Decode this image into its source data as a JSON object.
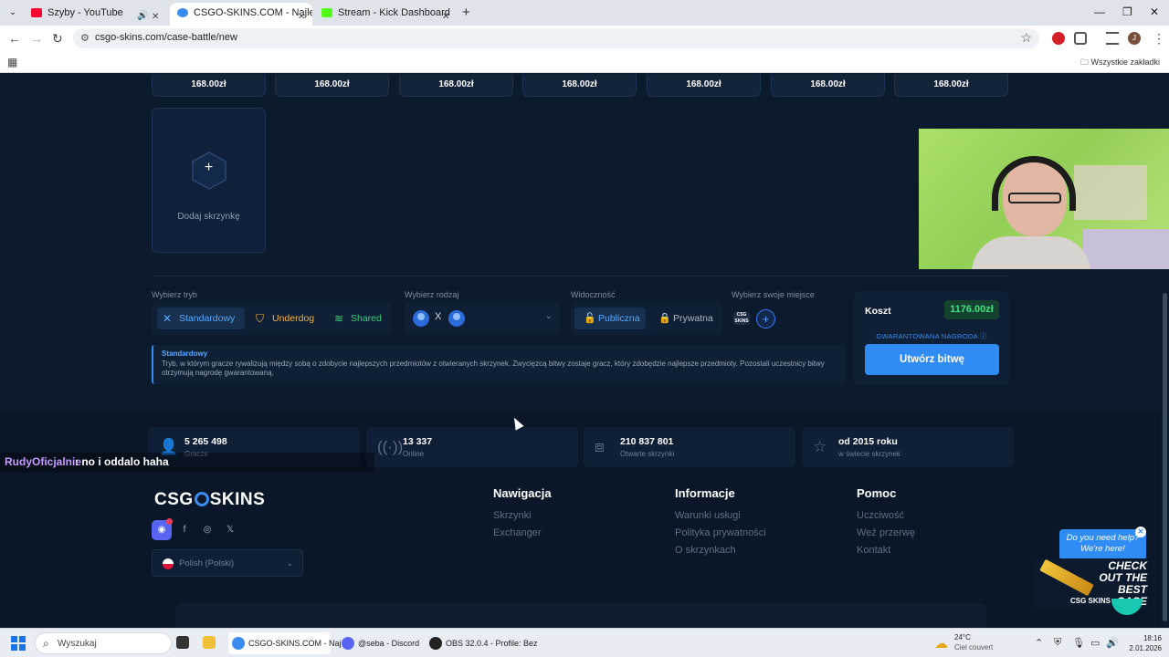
{
  "browser": {
    "tabs": [
      {
        "title": "Szyby - YouTube",
        "favicon_color": "#ff0033",
        "active": false
      },
      {
        "title": "CSGO-SKINS.COM - Najlepsze",
        "favicon_color": "#3a8cf0",
        "active": true
      },
      {
        "title": "Stream - Kick Dashboard",
        "favicon_color": "#53fc18",
        "active": false
      }
    ],
    "url": "csgo-skins.com/case-battle/new",
    "bookmarks_all": "Wszystkie zakładki",
    "profile_initial": "J"
  },
  "cases": {
    "prices": [
      "168.00zł",
      "168.00zł",
      "168.00zł",
      "168.00zł",
      "168.00zł",
      "168.00zł",
      "168.00zł"
    ],
    "add_label": "Dodaj skrzynkę",
    "add_symbol": "+"
  },
  "settings": {
    "mode_label": "Wybierz tryb",
    "modes": [
      "Standardowy",
      "Underdog",
      "Shared"
    ],
    "selected_mode": "Standardowy",
    "kind_label": "Wybierz rodzaj",
    "kind_separator": "X",
    "visibility_label": "Widoczność",
    "visibility": [
      "Publiczna",
      "Prywatna"
    ],
    "selected_visibility": "Publiczna",
    "seat_label": "Wybierz swoje miejsce",
    "seat_logo": "CSG SKINS"
  },
  "cost": {
    "label": "Koszt",
    "value": "1176.00zł",
    "guaranteed": "GWARANTOWANA NAGRODA",
    "create_button": "Utwórz bitwę"
  },
  "info": {
    "title": "Standardowy",
    "description": "Tryb, w którym gracze rywalizują między sobą o zdobycie najlepszych przedmiotów z otwieranych skrzynek. Zwycięzcą bitwy zostaje gracz, który zdobędzie najlepsze przedmioty. Pozostali uczestnicy bitwy otrzymują nagrodę gwarantowaną."
  },
  "stats": [
    {
      "value": "5 265 498",
      "label": "Gracze",
      "icon": "user-icon"
    },
    {
      "value": "13 337",
      "label": "Online",
      "icon": "broadcast-icon"
    },
    {
      "value": "210 837 801",
      "label": "Otwarte skrzynki",
      "icon": "box-icon"
    },
    {
      "value": "od 2015 roku",
      "label": "w świecie skrzynek",
      "icon": "star-icon"
    }
  ],
  "chat": {
    "user": "RudyOficjalnie",
    "message": ": no i oddalo haha"
  },
  "footer": {
    "logo_left": "CSG",
    "logo_right": "SKINS",
    "language": "Polish (Polski)",
    "columns": [
      {
        "title": "Nawigacja",
        "links": [
          "Skrzynki",
          "Exchanger"
        ]
      },
      {
        "title": "Informacje",
        "links": [
          "Warunki usługi",
          "Polityka prywatności",
          "O skrzynkach"
        ]
      },
      {
        "title": "Pomoc",
        "links": [
          "Uczciwość",
          "Weź przerwę",
          "Kontakt"
        ]
      }
    ]
  },
  "help_widget": {
    "bubble": "Do you need help? We're here!",
    "promo": "CHECK OUT THE BEST CASE",
    "brand": "CSG SKINS"
  },
  "taskbar": {
    "search_placeholder": "Wyszukaj",
    "apps": [
      {
        "label": "CSGO-SKINS.COM - Naj",
        "color": "#3a8cf0"
      },
      {
        "label": "@seba - Discord",
        "color": "#5865f2"
      },
      {
        "label": "OBS 32.0.4 - Profile: Bez",
        "color": "#222222"
      }
    ],
    "weather_temp": "24°C",
    "weather_desc": "Ciel couvert",
    "time": "18:16",
    "date": "2.01.2026"
  }
}
